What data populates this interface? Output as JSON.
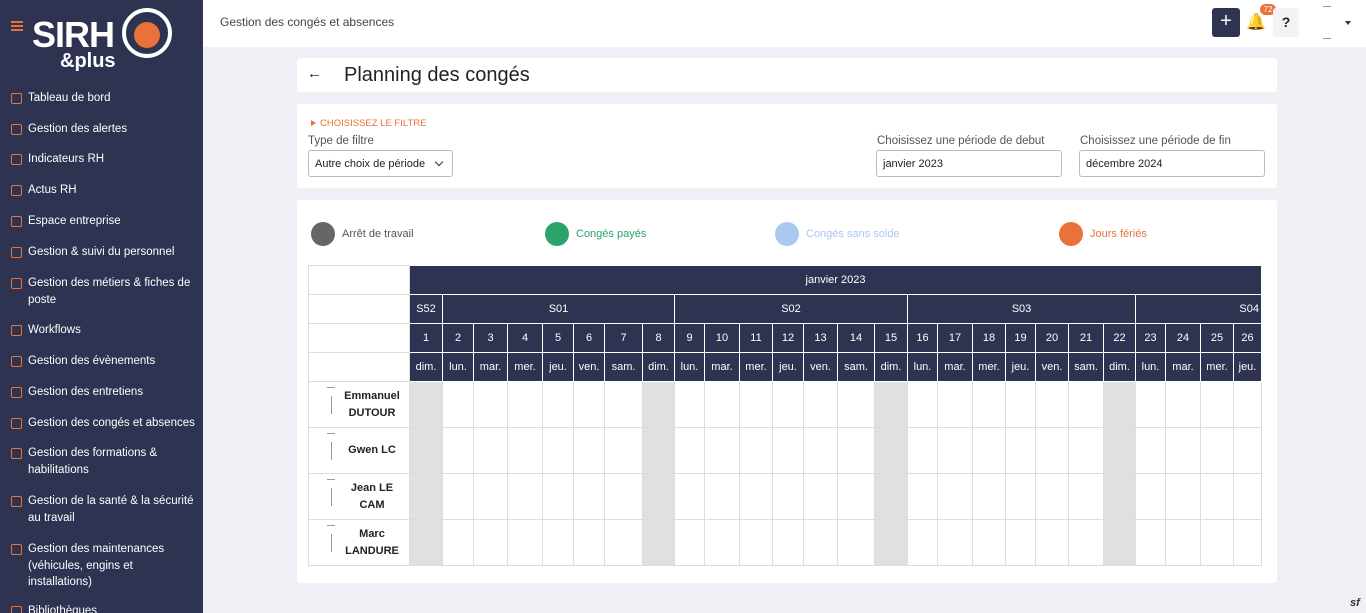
{
  "sidebar": {
    "logo_main": "SIRH",
    "logo_sub": "&plus",
    "items": [
      {
        "label": "Tableau de bord",
        "icon": "dashboard-icon"
      },
      {
        "label": "Gestion des alertes",
        "icon": "bell-icon"
      },
      {
        "label": "Indicateurs RH",
        "icon": "chart-icon"
      },
      {
        "label": "Actus RH",
        "icon": "book-icon"
      },
      {
        "label": "Espace entreprise",
        "icon": "briefcase-icon"
      },
      {
        "label": "Gestion & suivi du personnel",
        "icon": "users-icon"
      },
      {
        "label": "Gestion des métiers & fiches de poste",
        "icon": "briefcase-icon"
      },
      {
        "label": "Workflows",
        "icon": "workflow-icon"
      },
      {
        "label": "Gestion des évènements",
        "icon": "calendar-icon"
      },
      {
        "label": "Gestion des entretiens",
        "icon": "clipboard-icon"
      },
      {
        "label": "Gestion des congés et absences",
        "icon": "calendar-icon"
      },
      {
        "label": "Gestion des formations & habilitations",
        "icon": "graduation-icon"
      },
      {
        "label": "Gestion de la santé & la sécurité au travail",
        "icon": "heart-icon"
      },
      {
        "label": "Gestion des maintenances (véhicules, engins et installations)",
        "icon": "wrench-icon"
      },
      {
        "label": "Bibliothèques",
        "icon": "book-icon"
      }
    ]
  },
  "topbar": {
    "breadcrumb": "Gestion des congés et absences",
    "add_label": "+",
    "notifications_count": "72",
    "help_label": "?"
  },
  "page": {
    "back_label": "←",
    "title": "Planning des congés"
  },
  "filter": {
    "toggle_label": "CHOISISSEZ LE FILTRE",
    "type_label": "Type de filtre",
    "type_value": "Autre choix de période",
    "start_label": "Choisissez une période de debut",
    "start_value": "janvier 2023",
    "end_label": "Choisissez une période de fin",
    "end_value": "décembre 2024"
  },
  "legend": [
    {
      "label": "Arrêt de travail",
      "color": "#666666",
      "text_color": "#555555"
    },
    {
      "label": "Congés payés",
      "color": "#2ba36a",
      "text_color": "#2ba36a"
    },
    {
      "label": "Congés sans solde",
      "color": "#a9c8f2",
      "text_color": "#a9c8f2"
    },
    {
      "label": "Jours fériés",
      "color": "#e8723a",
      "text_color": "#e8723a"
    }
  ],
  "planning": {
    "month": "janvier 2023",
    "weeks": [
      {
        "label": "S52",
        "span": 1
      },
      {
        "label": "S01",
        "span": 7
      },
      {
        "label": "S02",
        "span": 7
      },
      {
        "label": "S03",
        "span": 7
      },
      {
        "label": "S04",
        "span": 4
      }
    ],
    "days": [
      "1",
      "2",
      "3",
      "4",
      "5",
      "6",
      "7",
      "8",
      "9",
      "10",
      "11",
      "12",
      "13",
      "14",
      "15",
      "16",
      "17",
      "18",
      "19",
      "20",
      "21",
      "22",
      "23",
      "24",
      "25",
      "26"
    ],
    "weekdays": [
      "dim.",
      "lun.",
      "mar.",
      "mer.",
      "jeu.",
      "ven.",
      "sam.",
      "dim.",
      "lun.",
      "mar.",
      "mer.",
      "jeu.",
      "ven.",
      "sam.",
      "dim.",
      "lun.",
      "mar.",
      "mer.",
      "jeu.",
      "ven.",
      "sam.",
      "dim.",
      "lun.",
      "mar.",
      "mer.",
      "jeu."
    ],
    "employees": [
      "Emmanuel DUTOUR",
      "Gwen LC",
      "Jean LE CAM",
      "Marc LANDURE"
    ]
  },
  "footer_glyph": "sf"
}
